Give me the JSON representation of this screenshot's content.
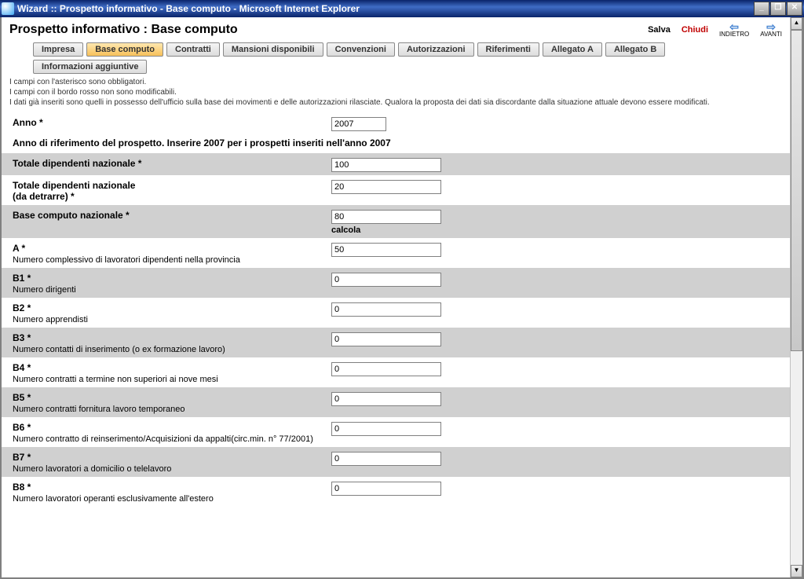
{
  "window": {
    "title": "Wizard :: Prospetto informativo - Base computo - Microsoft Internet Explorer"
  },
  "header": {
    "title": "Prospetto informativo : Base computo",
    "save": "Salva",
    "close": "Chiudi",
    "back": "INDIETRO",
    "forward": "AVANTI"
  },
  "tabs": [
    "Impresa",
    "Base computo",
    "Contratti",
    "Mansioni disponibili",
    "Convenzioni",
    "Autorizzazioni",
    "Riferimenti",
    "Allegato A",
    "Allegato B",
    "Informazioni aggiuntive"
  ],
  "notes": {
    "l1": "I campi con l'asterisco sono obbligatori.",
    "l2": "I campi con il bordo rosso non sono modificabili.",
    "l3": "I dati già inseriti sono quelli in possesso dell'ufficio sulla base dei movimenti e delle autorizzazioni rilasciate. Qualora la proposta dei dati sia discordante dalla situazione attuale devono essere modificati."
  },
  "fields": {
    "anno": {
      "label": "Anno *",
      "value": "2007",
      "help": "Anno di riferimento del prospetto. Inserire 2007 per i prospetti inseriti nell'anno 2007"
    },
    "tot_naz": {
      "label": "Totale dipendenti nazionale *",
      "value": "100"
    },
    "tot_naz_detr": {
      "label": "Totale dipendenti nazionale",
      "label2": "(da detrarre) *",
      "value": "20"
    },
    "base": {
      "label": "Base computo nazionale *",
      "value": "80",
      "calc": "calcola"
    },
    "a": {
      "label": "A *",
      "sub": "Numero complessivo di lavoratori dipendenti nella provincia",
      "value": "50"
    },
    "b1": {
      "label": "B1 *",
      "sub": "Numero dirigenti",
      "value": "0"
    },
    "b2": {
      "label": "B2 *",
      "sub": "Numero apprendisti",
      "value": "0"
    },
    "b3": {
      "label": "B3 *",
      "sub": "Numero contatti di inserimento (o ex formazione lavoro)",
      "value": "0"
    },
    "b4": {
      "label": "B4 *",
      "sub": "Numero contratti a termine non superiori ai nove mesi",
      "value": "0"
    },
    "b5": {
      "label": "B5 *",
      "sub": "Numero contratti fornitura lavoro temporaneo",
      "value": "0"
    },
    "b6": {
      "label": "B6 *",
      "sub": "Numero contratto di reinserimento/Acquisizioni da appalti(circ.min. n° 77/2001)",
      "value": "0"
    },
    "b7": {
      "label": "B7 *",
      "sub": "Numero lavoratori a domicilio o telelavoro",
      "value": "0"
    },
    "b8": {
      "label": "B8 *",
      "sub": "Numero lavoratori operanti esclusivamente all'estero",
      "value": "0"
    }
  }
}
